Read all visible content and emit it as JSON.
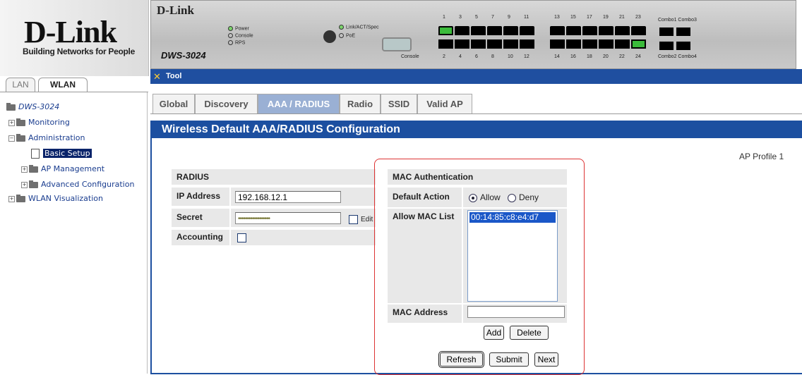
{
  "brand": {
    "logo": "D-Link",
    "tagline": "Building Networks for People"
  },
  "device": {
    "logo": "D-Link",
    "model": "DWS-3024",
    "leds_left": [
      "Power",
      "Console",
      "RPS"
    ],
    "leds_right": [
      "Link/ACT/Spec",
      "PoE"
    ],
    "console_label": "Console",
    "top_port_numbers": [
      "1",
      "3",
      "5",
      "7",
      "9",
      "11",
      "13",
      "15",
      "17",
      "19",
      "21",
      "23"
    ],
    "bottom_port_numbers": [
      "2",
      "4",
      "6",
      "8",
      "10",
      "12",
      "14",
      "16",
      "18",
      "20",
      "22",
      "24"
    ],
    "combo_top": "Combo1 Combo3",
    "combo_bottom": "Combo2 Combo4"
  },
  "nav": {
    "tabs": {
      "lan": "LAN",
      "wlan": "WLAN"
    },
    "tree": {
      "root": "DWS-3024",
      "monitoring": "Monitoring",
      "administration": "Administration",
      "basic_setup": "Basic Setup",
      "ap_management": "AP Management",
      "advanced_configuration": "Advanced Configuration",
      "wlan_visualization": "WLAN Visualization"
    }
  },
  "toolbar": {
    "tool": "Tool"
  },
  "tabs": {
    "global": "Global",
    "discovery": "Discovery",
    "aaa_radius": "AAA / RADIUS",
    "radio": "Radio",
    "ssid": "SSID",
    "valid_ap": "Valid AP"
  },
  "page": {
    "title": "Wireless Default AAA/RADIUS Configuration",
    "ap_profile": "AP Profile 1"
  },
  "radius": {
    "heading": "RADIUS",
    "ip_label": "IP Address",
    "ip_value": "192.168.12.1",
    "secret_label": "Secret",
    "secret_value": "••••••••••••••••••",
    "edit_label": "Edit",
    "accounting_label": "Accounting"
  },
  "mac_auth": {
    "heading": "MAC Authentication",
    "default_action_label": "Default Action",
    "allow_label": "Allow",
    "deny_label": "Deny",
    "selected_action": "Allow",
    "allow_list_label": "Allow MAC List",
    "allow_list": [
      "00:14:85:c8:e4:d7"
    ],
    "mac_address_label": "MAC Address",
    "mac_address_value": "",
    "add_button": "Add",
    "delete_button": "Delete"
  },
  "buttons": {
    "refresh": "Refresh",
    "submit": "Submit",
    "next": "Next"
  }
}
